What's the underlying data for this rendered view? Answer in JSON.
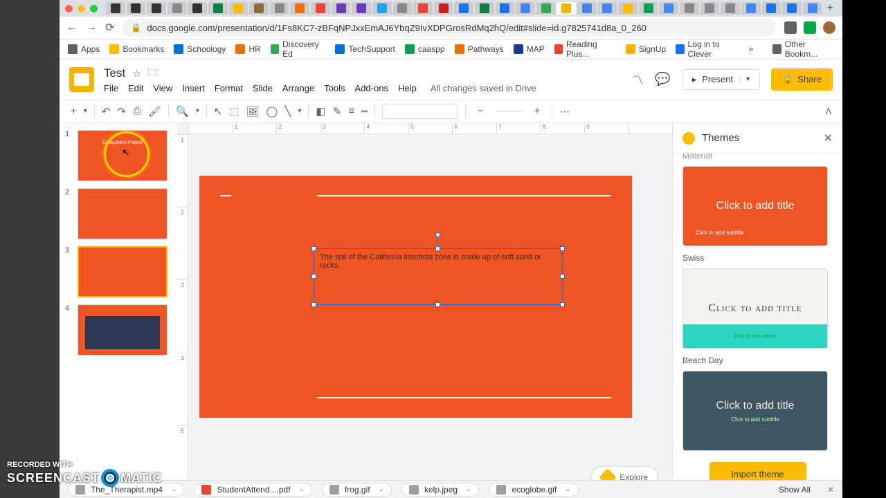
{
  "url": "docs.google.com/presentation/d/1Fs8KC7-zBFqNPJxxEmAJ6YbqZ9IvXDPGrosRdMq2hQ/edit#slide=id.g7825741d8a_0_260",
  "bookmarks": {
    "apps": "Apps",
    "bookmarks": "Bookmarks",
    "schoology": "Schoology",
    "hr": "HR",
    "discovery": "Discovery Ed",
    "techsupport": "TechSupport",
    "caaspp": "caaspp",
    "pathways": "Pathways",
    "map": "MAP",
    "readingplus": "Reading Plus...",
    "signup": "SignUp",
    "clever": "Log in to Clever",
    "more": "»",
    "other": "Other Bookm..."
  },
  "doc": {
    "title": "Test",
    "saved": "All changes saved in Drive"
  },
  "menus": {
    "file": "File",
    "edit": "Edit",
    "view": "View",
    "insert": "Insert",
    "format": "Format",
    "slide": "Slide",
    "arrange": "Arrange",
    "tools": "Tools",
    "addons": "Add-ons",
    "help": "Help"
  },
  "header_buttons": {
    "present": "Present",
    "share": "Share"
  },
  "ruler_h": [
    "",
    "1",
    "2",
    "3",
    "4",
    "5",
    "6",
    "7",
    "8",
    "9",
    ""
  ],
  "ruler_v": [
    "1",
    "2",
    "3",
    "4",
    "5"
  ],
  "slides": [
    {
      "num": "1",
      "title": "Ecosystem Project"
    },
    {
      "num": "2",
      "title": ""
    },
    {
      "num": "3",
      "title": ""
    },
    {
      "num": "4",
      "title": ""
    }
  ],
  "textbox_content": "The soil of the California intertidal zone is made up of soft sand or rocks.",
  "explore": "Explore",
  "themes": {
    "title": "Themes",
    "material": "Material",
    "swiss": "Swiss",
    "beach": "Beach Day",
    "card_title": "Click to add title",
    "card_sub": "Click to add subtitle",
    "swiss_title": "Click to add title",
    "import": "Import theme"
  },
  "downloads": {
    "d1": "The_Therapist.mp4",
    "d2": "StudentAttend....pdf",
    "d3": "frog.gif",
    "d4": "kelp.jpeg",
    "d5": "ecoglobe.gif",
    "showall": "Show All"
  },
  "watermark": {
    "line1": "RECORDED WITH",
    "line2a": "SCREENCAST",
    "line2b": "MATIC"
  }
}
